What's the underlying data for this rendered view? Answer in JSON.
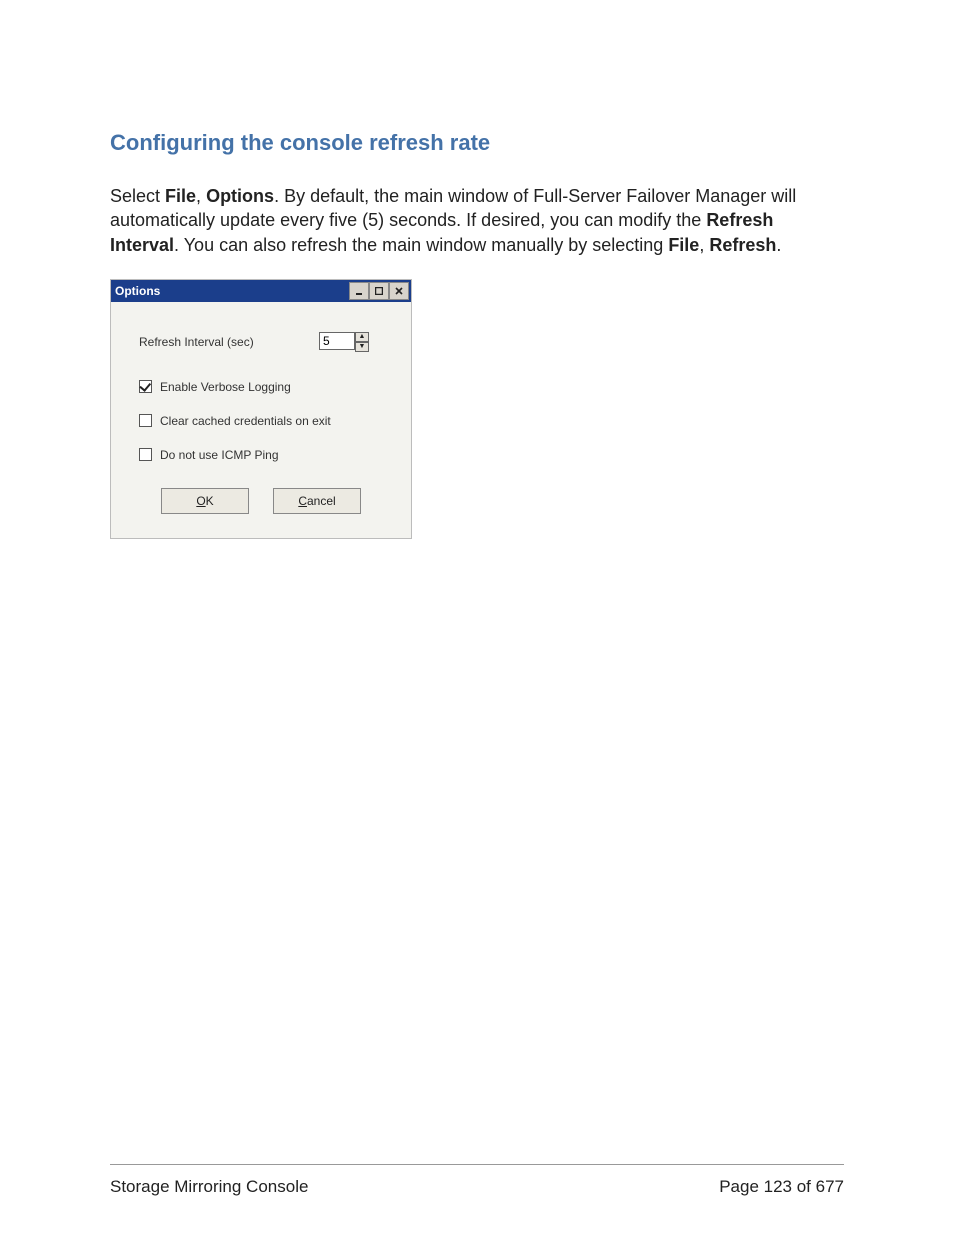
{
  "heading": "Configuring the console refresh rate",
  "paragraph": {
    "p1a": "Select ",
    "p1b": "File",
    "p1c": ", ",
    "p1d": "Options",
    "p1e": ". By default, the main window of Full-Server Failover Manager will automatically update every five (5) seconds. If desired, you can modify the ",
    "p1f": "Refresh Interval",
    "p1g": ". You can also refresh the main window manually by selecting ",
    "p1h": "File",
    "p1i": ", ",
    "p1j": "Refresh",
    "p1k": "."
  },
  "dialog": {
    "title": "Options",
    "refresh_label": "Refresh Interval (sec)",
    "refresh_value": "5",
    "verbose_label": "Enable Verbose Logging",
    "verbose_checked": true,
    "clear_label": "Clear cached credentials on exit",
    "clear_checked": false,
    "icmp_label": "Do not use ICMP Ping",
    "icmp_checked": false,
    "ok_label": "OK",
    "ok_accel": "O",
    "cancel_label": "Cancel",
    "cancel_accel": "C"
  },
  "footer": {
    "left": "Storage Mirroring Console",
    "right": "Page 123 of 677"
  }
}
